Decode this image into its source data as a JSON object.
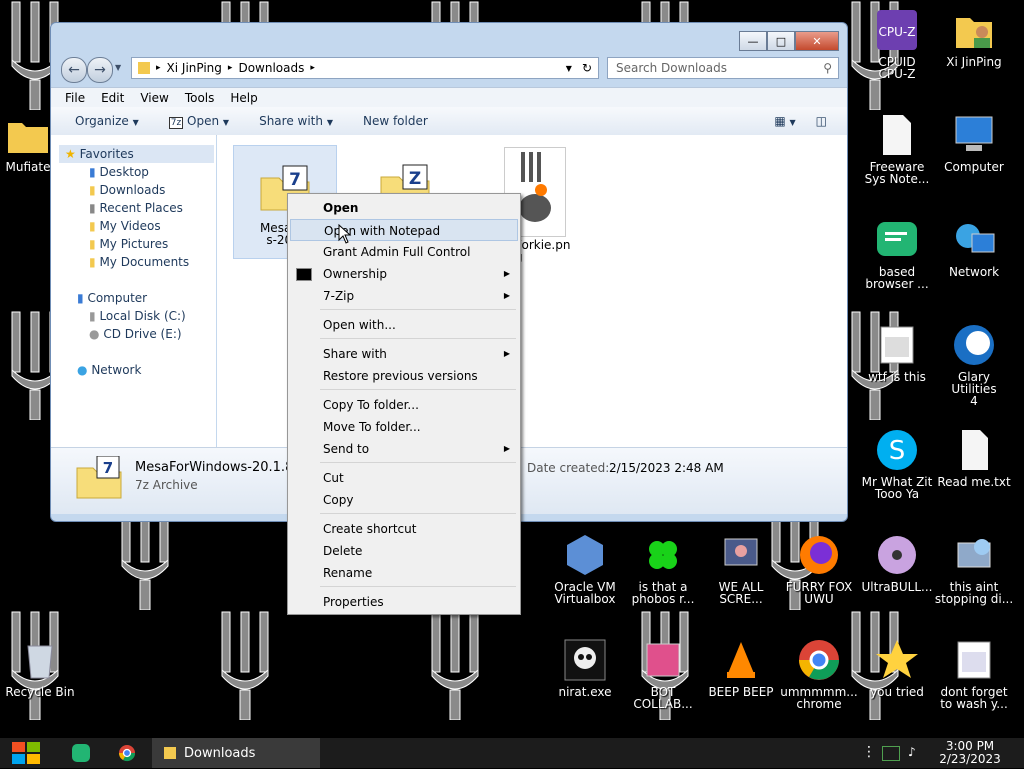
{
  "explorer": {
    "breadcrumb": [
      "Xi JinPing",
      "Downloads"
    ],
    "search_placeholder": "Search Downloads",
    "menu": [
      "File",
      "Edit",
      "View",
      "Tools",
      "Help"
    ],
    "commands": {
      "organize": "Organize",
      "open": "Open",
      "share": "Share with",
      "new_folder": "New folder"
    },
    "nav": {
      "favorites": "Favorites",
      "fav_items": [
        "Desktop",
        "Downloads",
        "Recent Places",
        "My Videos",
        "My Pictures",
        "My Documents"
      ],
      "computer": "Computer",
      "drives": [
        "Local Disk (C:)",
        "CD Drive (E:)"
      ],
      "network": "Network"
    },
    "files": [
      {
        "line1": "MesaFor",
        "line2": "s-20.1"
      },
      {
        "line1": "Forkie.pn",
        "line2": "g"
      }
    ],
    "details": {
      "name": "MesaForWindows-20.1.8.",
      "type": "7z Archive",
      "date_label": "Date created:",
      "date": "2/15/2023 2:48 AM"
    }
  },
  "context_menu": [
    {
      "label": "Open",
      "bold": true
    },
    {
      "label": "Open with Notepad"
    },
    {
      "label": "Grant Admin Full Control"
    },
    {
      "label": "Ownership"
    },
    {
      "label": "7-Zip"
    },
    {
      "label": "Open with..."
    },
    {
      "label": "Share with"
    },
    {
      "label": "Restore previous versions"
    },
    {
      "label": "Copy To folder..."
    },
    {
      "label": "Move To folder..."
    },
    {
      "label": "Send to"
    },
    {
      "label": "Cut"
    },
    {
      "label": "Copy"
    },
    {
      "label": "Create shortcut"
    },
    {
      "label": "Delete"
    },
    {
      "label": "Rename"
    },
    {
      "label": "Properties"
    }
  ],
  "desktop_icons": [
    {
      "line1": "CPUID",
      "line2": "CPU-Z",
      "icon": "cpuz-icon"
    },
    {
      "line1": "Xi JinPing",
      "line2": "",
      "icon": "user-folder-icon"
    },
    {
      "line1": "Freeware",
      "line2": "Sys Note...",
      "icon": "document-icon"
    },
    {
      "line1": "Computer",
      "line2": "",
      "icon": "computer-icon"
    },
    {
      "line1": "based",
      "line2": "browser ...",
      "icon": "browser-icon"
    },
    {
      "line1": "Network",
      "line2": "",
      "icon": "network-icon"
    },
    {
      "line1": "wtf is this",
      "line2": "",
      "icon": "app-icon"
    },
    {
      "line1": "Glary Utilities",
      "line2": "4",
      "icon": "glary-icon"
    },
    {
      "line1": "Mr What Zit",
      "line2": "Tooo Ya",
      "icon": "skype-icon"
    },
    {
      "line1": "Read me.txt",
      "line2": "",
      "icon": "text-file-icon"
    },
    {
      "line1": "Oracle VM",
      "line2": "Virtualbox",
      "icon": "virtualbox-icon"
    },
    {
      "line1": "is that a",
      "line2": "phobos r...",
      "icon": "clover-icon"
    },
    {
      "line1": "WE ALL",
      "line2": "SCRE...",
      "icon": "scream-icon"
    },
    {
      "line1": "FURRY FOX",
      "line2": "UWU",
      "icon": "firefox-icon"
    },
    {
      "line1": "UltraBULL...",
      "line2": "",
      "icon": "disc-icon"
    },
    {
      "line1": "this aint",
      "line2": "stopping di...",
      "icon": "installer-icon"
    },
    {
      "line1": "Mufiate",
      "line2": "",
      "icon": "folder-icon"
    },
    {
      "line1": "Recycle Bin",
      "line2": "",
      "icon": "recycle-bin-icon"
    },
    {
      "line1": "nirat.exe",
      "line2": "",
      "icon": "skull-icon"
    },
    {
      "line1": "BOT",
      "line2": "COLLAB...",
      "icon": "film-icon"
    },
    {
      "line1": "BEEP BEEP",
      "line2": "",
      "icon": "vlc-icon"
    },
    {
      "line1": "ummmmm...",
      "line2": "chrome",
      "icon": "chrome-icon"
    },
    {
      "line1": "you tried",
      "line2": "",
      "icon": "star-icon"
    },
    {
      "line1": "dont forget",
      "line2": "to wash y...",
      "icon": "calendar-icon"
    }
  ],
  "taskbar": {
    "window_label": "Downloads",
    "time": "3:00 PM",
    "date": "2/23/2023"
  }
}
